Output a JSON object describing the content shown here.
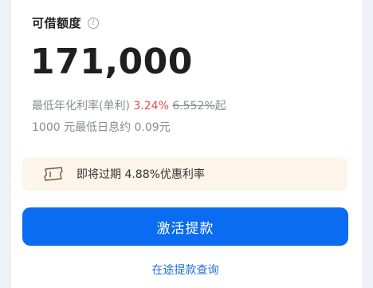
{
  "credit": {
    "label": "可借额度",
    "amount": "171,000"
  },
  "rate": {
    "prefix": "最低年化利率(单利)",
    "current": "3.24%",
    "original": "6.552%",
    "suffix": "起"
  },
  "interest": {
    "text": "1000 元最低日息约 0.09元"
  },
  "coupon": {
    "text": "即将过期 4.88%优惠利率"
  },
  "actions": {
    "primary_label": "激活提款",
    "link_label": "在途提款查询"
  },
  "colors": {
    "accent": "#0a6cf0",
    "highlight": "#e84a4a",
    "coupon_bg": "#fdf5ea"
  },
  "icons": {
    "info": "info-icon",
    "ticket": "ticket-icon"
  }
}
